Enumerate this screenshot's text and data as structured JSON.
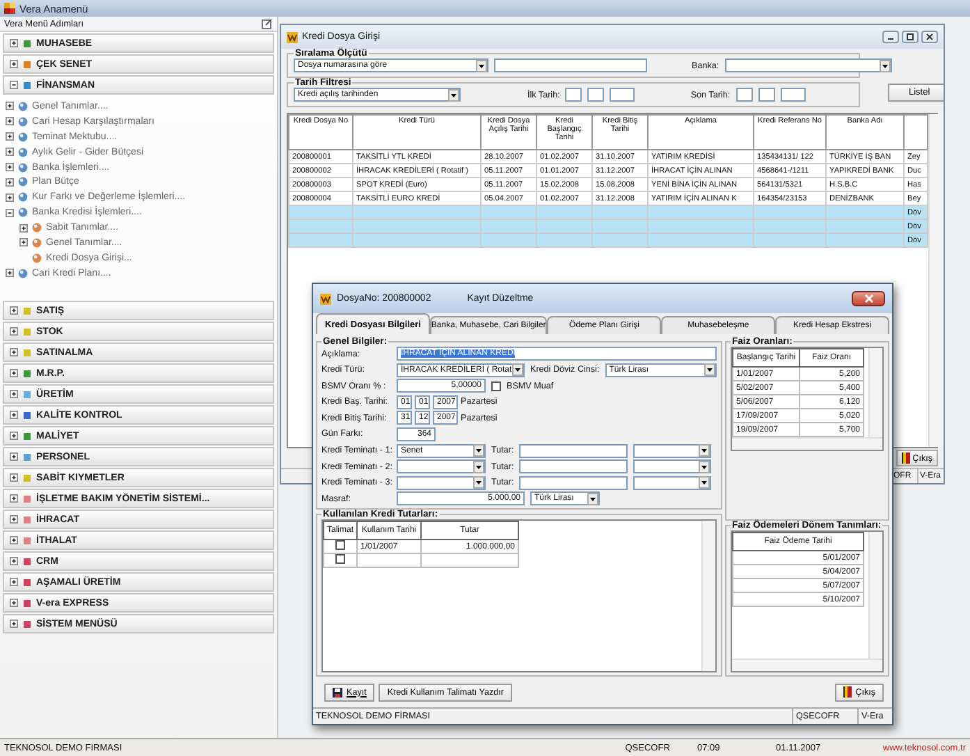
{
  "app_title": "Vera Anamenü",
  "sidebar": {
    "title": "Vera Menü Adımları",
    "groups": [
      {
        "label": "MUHASEBE",
        "color": "#3a9a3a",
        "expanded": false
      },
      {
        "label": "ÇEK SENET",
        "color": "#e08020",
        "expanded": false
      },
      {
        "label": "FİNANSMAN",
        "color": "#3a8ad0",
        "expanded": true,
        "children": [
          {
            "label": "Genel Tanımlar....",
            "kind": "folder",
            "expanded": false
          },
          {
            "label": "Cari Hesap Karşılaştırmaları",
            "kind": "folder",
            "expanded": false
          },
          {
            "label": "Teminat Mektubu....",
            "kind": "folder",
            "expanded": false
          },
          {
            "label": "Aylık Gelir - Gider Bütçesi",
            "kind": "folder",
            "expanded": false
          },
          {
            "label": "Banka İşlemleri....",
            "kind": "folder",
            "expanded": false
          },
          {
            "label": "Plan Bütçe",
            "kind": "folder",
            "expanded": false
          },
          {
            "label": "Kur Farkı ve Değerleme İşlemleri....",
            "kind": "folder",
            "expanded": false
          },
          {
            "label": "Banka Kredisi İşlemleri....",
            "kind": "folder",
            "expanded": true,
            "children": [
              {
                "label": "Sabit Tanımlar....",
                "kind": "folder",
                "expanded": false
              },
              {
                "label": "Genel Tanımlar....",
                "kind": "folder",
                "expanded": false
              },
              {
                "label": "Kredi Dosya Girişi...",
                "kind": "leaf"
              }
            ]
          },
          {
            "label": "Cari Kredi Planı....",
            "kind": "folder",
            "expanded": false
          }
        ]
      },
      {
        "label": "SATIŞ",
        "color": "#d0c020",
        "expanded": false
      },
      {
        "label": "STOK",
        "color": "#d0c020",
        "expanded": false
      },
      {
        "label": "SATINALMA",
        "color": "#d0c020",
        "expanded": false
      },
      {
        "label": "M.R.P.",
        "color": "#3a9a3a",
        "expanded": false
      },
      {
        "label": "ÜRETİM",
        "color": "#60b0e0",
        "expanded": false
      },
      {
        "label": "KALİTE KONTROL",
        "color": "#3a6ad0",
        "expanded": false
      },
      {
        "label": "MALİYET",
        "color": "#3a9a3a",
        "expanded": false
      },
      {
        "label": "PERSONEL",
        "color": "#60a0d0",
        "expanded": false
      },
      {
        "label": "SABİT KIYMETLER",
        "color": "#d0c020",
        "expanded": false
      },
      {
        "label": "İŞLETME BAKIM YÖNETİM SİSTEMİ...",
        "color": "#e08080",
        "expanded": false
      },
      {
        "label": "İHRACAT",
        "color": "#e08080",
        "expanded": false
      },
      {
        "label": "İTHALAT",
        "color": "#e08080",
        "expanded": false
      },
      {
        "label": "CRM",
        "color": "#d04060",
        "expanded": false
      },
      {
        "label": "AŞAMALI ÜRETİM",
        "color": "#d04060",
        "expanded": false
      },
      {
        "label": "V-era EXPRESS",
        "color": "#d04060",
        "expanded": false
      },
      {
        "label": "SİSTEM MENÜSÜ",
        "color": "#d04060",
        "expanded": false
      }
    ]
  },
  "main_window": {
    "title": "Kredi Dosya Girişi",
    "sort": {
      "title": "Sıralama Ölçütü",
      "value": "Dosya numarasına göre",
      "bank_label": "Banka:"
    },
    "date_filter": {
      "title": "Tarih Filtresi",
      "value": "Kredi açılış tarihinden",
      "first_label": "İlk Tarih:",
      "last_label": "Son Tarih:"
    },
    "list_button": "Listel",
    "table": {
      "columns": [
        "Kredi Dosya No",
        "Kredi Türü",
        "Kredi Dosya Açılış Tarihi",
        "Kredi Başlangıç Tarihi",
        "Kredi Bitiş Tarihi",
        "Açıklama",
        "Kredi Referans No",
        "Banka Adı"
      ],
      "rows": [
        {
          "highlighted": false,
          "cells": [
            "200800001",
            "TAKSİTLİ YTL KREDİ",
            "28.10.2007",
            "01.02.2007",
            "31.10.2007",
            "YATIRIM KREDİSİ",
            "135434131/ 122",
            "TÜRKİYE İŞ BAN",
            "Zey"
          ]
        },
        {
          "highlighted": false,
          "cells": [
            "200800002",
            "İHRACAK KREDİLERİ ( Rotatif )",
            "05.11.2007",
            "01.01.2007",
            "31.12.2007",
            "İHRACAT İÇİN ALINAN",
            "4568641-/1211",
            "YAPIKREDİ BANK",
            "Duc"
          ]
        },
        {
          "highlighted": false,
          "cells": [
            "200800003",
            "SPOT KREDİ (Euro)",
            "05.11.2007",
            "15.02.2008",
            "15.08.2008",
            "YENİ BİNA İÇİN ALINAN",
            "564131/5321",
            "H.S.B.C",
            "Has"
          ]
        },
        {
          "highlighted": false,
          "cells": [
            "200800004",
            "TAKSİTLİ EURO KREDİ",
            "05.04.2007",
            "01.02.2007",
            "31.12.2008",
            "YATIRIM İÇİN ALINAN K",
            "164354/23153",
            "DENİZBANK",
            "Bey"
          ]
        },
        {
          "highlighted": true,
          "column_9": "Döv"
        },
        {
          "highlighted": true,
          "column_9": "Döv"
        },
        {
          "highlighted": true,
          "column_9": "Döv"
        }
      ]
    },
    "exit_button": "Çıkış",
    "status": [
      "OFR",
      "V-Era"
    ]
  },
  "dialog": {
    "title": "DosyaNo: 200800002",
    "mode": "Kayıt Düzeltme",
    "tabs": [
      {
        "label": "Kredi Dosyası Bilgileri",
        "selected": true
      },
      {
        "label": "Banka, Muhasebe, Cari Bilgiler",
        "selected": false
      },
      {
        "label": "Ödeme Planı Girişi",
        "selected": false
      },
      {
        "label": "Muhasebeleşme",
        "selected": false
      },
      {
        "label": "Kredi Hesap Ekstresi",
        "selected": false
      }
    ],
    "general": {
      "title": "Genel Bilgiler:",
      "description": {
        "label": "Açıklama:",
        "value": "İHRACAT İÇİN ALINAN KREDİ",
        "text_selected": true
      },
      "credit_type": {
        "label": "Kredi Türü:",
        "value": "İHRACAK KREDİLERİ ( Rotat"
      },
      "currency": {
        "label": "Kredi Döviz Cinsi:",
        "value": "Türk Lirası"
      },
      "bsmv_rate": {
        "label": "BSMV Oranı % :",
        "value": "5,00000"
      },
      "bsmv_exempt": {
        "label": "BSMV Muaf",
        "checked": false
      },
      "start_date": {
        "label": "Kredi Baş. Tarihi:",
        "day": "01",
        "month": "01",
        "year": "2007",
        "weekday": "Pazartesi"
      },
      "end_date": {
        "label": "Kredi Bitiş Tarihi:",
        "day": "31",
        "month": "12",
        "year": "2007",
        "weekday": "Pazartesi"
      },
      "day_diff": {
        "label": "Gün Farkı:",
        "value": "364"
      },
      "collaterals": [
        {
          "label": "Kredi Teminatı - 1:",
          "type": "Senet",
          "amount_label": "Tutar:"
        },
        {
          "label": "Kredi Teminatı - 2:",
          "amount_label": "Tutar:"
        },
        {
          "label": "Kredi Teminatı - 3:",
          "amount_label": "Tutar:"
        }
      ],
      "expense": {
        "label": "Masraf:",
        "value": "5.000,00",
        "currency": "Türk Lirası"
      }
    },
    "used_credits": {
      "title": "Kullanılan Kredi Tutarları:",
      "columns": [
        "Talimat",
        "Kullanım Tarihi",
        "Tutar"
      ],
      "rows": [
        {
          "checked": false,
          "date": "1/01/2007",
          "amount": "1.000.000,00"
        },
        {
          "checked": false
        }
      ]
    },
    "interest_rates": {
      "title": "Faiz Oranları:",
      "columns": [
        "Başlangıç Tarihi",
        "Faiz Oranı"
      ],
      "rows": [
        [
          "1/01/2007",
          "5,200"
        ],
        [
          "5/02/2007",
          "5,400"
        ],
        [
          "5/06/2007",
          "6,120"
        ],
        [
          "17/09/2007",
          "5,020"
        ],
        [
          "19/09/2007",
          "5,700"
        ]
      ]
    },
    "interest_payments": {
      "title": "Faiz Ödemeleri Dönem Tanımları:",
      "columns": [
        "Faiz Ödeme Tarihi"
      ],
      "rows": [
        "5/01/2007",
        "5/04/2007",
        "5/07/2007",
        "5/10/2007"
      ]
    },
    "save_button": "Kayıt",
    "print_button": "Kredi Kullanım Talimatı Yazdır",
    "exit_button": "Çıkış",
    "status": [
      "TEKNOSOL DEMO FİRMASI",
      "QSECOFR",
      "V-Era"
    ]
  },
  "status_bar": [
    "TEKNOSOL DEMO FIRMASI",
    "QSECOFR",
    "07:09",
    "01.11.2007",
    "www.teknosol.com.tr"
  ]
}
